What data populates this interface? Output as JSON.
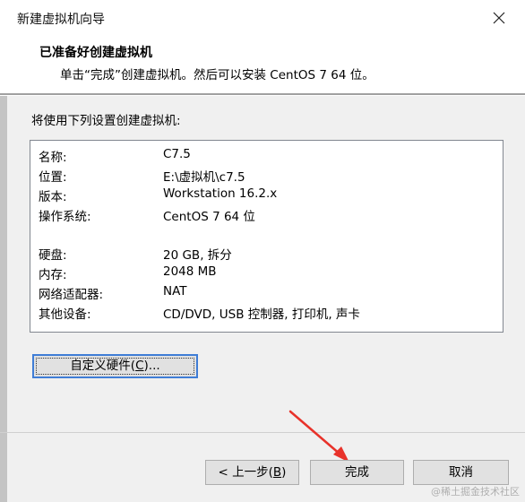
{
  "window": {
    "title": "新建虚拟机向导"
  },
  "header": {
    "title": "已准备好创建虚拟机",
    "description": "单击“完成”创建虚拟机。然后可以安装 CentOS 7 64 位。"
  },
  "main": {
    "section_label": "将使用下列设置创建虚拟机:",
    "settings_group_1": [
      {
        "key": "名称:",
        "value": "C7.5"
      },
      {
        "key": "位置:",
        "value": "E:\\虚拟机\\c7.5"
      },
      {
        "key": "版本:",
        "value": "Workstation 16.2.x"
      },
      {
        "key": "操作系统:",
        "value": "CentOS 7 64 位"
      }
    ],
    "settings_group_2": [
      {
        "key": "硬盘:",
        "value": "20 GB, 拆分"
      },
      {
        "key": "内存:",
        "value": "2048 MB"
      },
      {
        "key": "网络适配器:",
        "value": "NAT"
      },
      {
        "key": "其他设备:",
        "value": "CD/DVD, USB 控制器, 打印机, 声卡"
      }
    ],
    "customize_hardware": {
      "prefix": "自定义硬件(",
      "mnemonic": "C",
      "suffix": ")..."
    }
  },
  "footer": {
    "back": {
      "prefix": "< 上一步(",
      "mnemonic": "B",
      "suffix": ")"
    },
    "finish": "完成",
    "cancel": "取消"
  },
  "watermark": "@稀土掘金技术社区",
  "colors": {
    "window_bg": "#f0f0f0",
    "focus_border": "#3f7dd6",
    "annotation_arrow": "#e8322a"
  },
  "icons": {
    "close": "close-icon",
    "annotation": "red-arrow-icon"
  }
}
